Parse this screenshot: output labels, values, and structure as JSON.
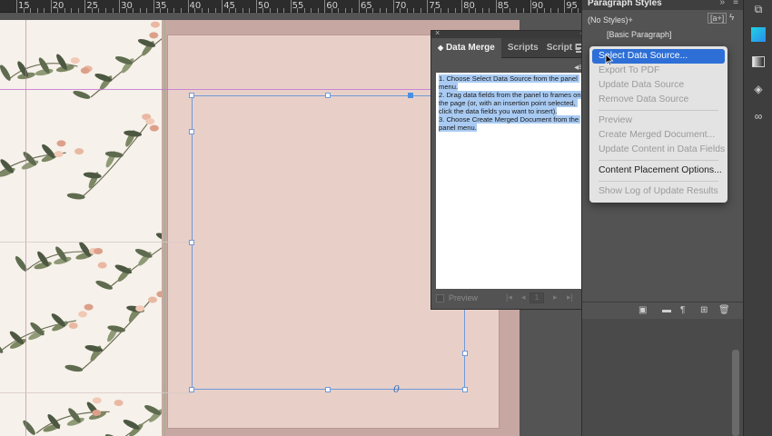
{
  "ruler": {
    "labels": [
      "15",
      "20",
      "25",
      "30",
      "35",
      "40",
      "45",
      "50",
      "55",
      "60",
      "65",
      "70",
      "75",
      "80",
      "85",
      "90",
      "95"
    ]
  },
  "data_merge_panel": {
    "close_glyph": "×",
    "collapse_glyph": "‹‹",
    "tabs": [
      {
        "label": "Data Merge",
        "active": true
      },
      {
        "label": "Scripts",
        "active": false
      },
      {
        "label": "Script L",
        "active": false
      }
    ],
    "instructions": "1. Choose Select Data Source from the panel menu.\n2. Drag data fields from the panel to frames on the page (or, with an insertion point selected, click the data fields you want to insert).\n3. Choose Create Merged Document from the panel menu.",
    "footer": {
      "preview_label": "Preview",
      "page_number": "1"
    }
  },
  "paragraph_styles_panel": {
    "title": "Paragraph Styles",
    "current_style": "(No Styles)+",
    "plus_badge": "[a+]",
    "styles": [
      "[Basic Paragraph]"
    ]
  },
  "panel_menu": {
    "groups": [
      [
        {
          "label": "Select Data Source...",
          "enabled": true,
          "selected": true
        },
        {
          "label": "Export To PDF",
          "enabled": false
        },
        {
          "label": "Update Data Source",
          "enabled": false
        },
        {
          "label": "Remove Data Source",
          "enabled": false
        }
      ],
      [
        {
          "label": "Preview",
          "enabled": false
        },
        {
          "label": "Create Merged Document...",
          "enabled": false
        },
        {
          "label": "Update Content in Data Fields",
          "enabled": false
        }
      ],
      [
        {
          "label": "Content Placement Options...",
          "enabled": true
        }
      ],
      [
        {
          "label": "Show Log of Update Results",
          "enabled": false
        }
      ]
    ]
  },
  "colors": {
    "selection_blue": "#2d6fd6",
    "frame_blue": "#6f9ad8",
    "page_pink": "#e8d0c9",
    "text_highlight": "#a9cbf3"
  },
  "icons": {
    "tools": [
      "cc-libraries-icon",
      "color-swatch-icon",
      "gradient-icon",
      "layers-icon",
      "links-icon"
    ],
    "ps_footer": [
      "new-group-icon",
      "folder-icon",
      "paragraph-style-icon",
      "new-style-icon",
      "trash-icon"
    ]
  }
}
